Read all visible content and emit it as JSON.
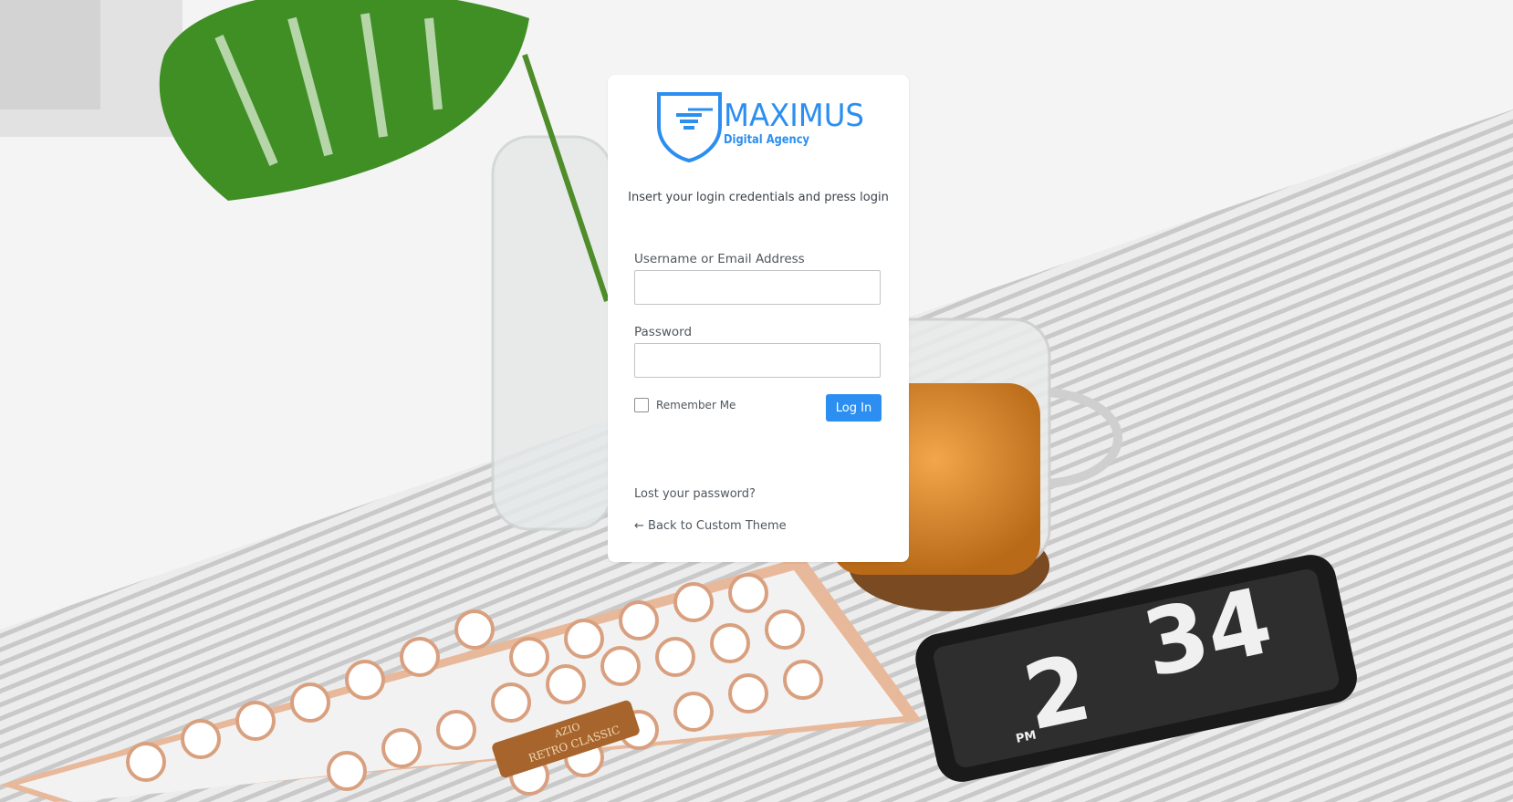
{
  "brand": {
    "name": "MAXIMUS",
    "tagline": "Digital Agency",
    "color": "#2b8ef0"
  },
  "login": {
    "intro": "Insert your login credentials and press login",
    "username_label": "Username or Email Address",
    "username_value": "",
    "password_label": "Password",
    "password_value": "",
    "remember_label": "Remember Me",
    "remember_checked": false,
    "submit_label": "Log In"
  },
  "links": {
    "lost_password": "Lost your password?",
    "back": "← Back to Custom Theme"
  },
  "background": {
    "phone_clock_hour": "2",
    "phone_clock_minutes": "34",
    "phone_clock_period": "PM",
    "keyboard_badge_line1": "AZIO",
    "keyboard_badge_line2": "RETRO CLASSIC"
  }
}
